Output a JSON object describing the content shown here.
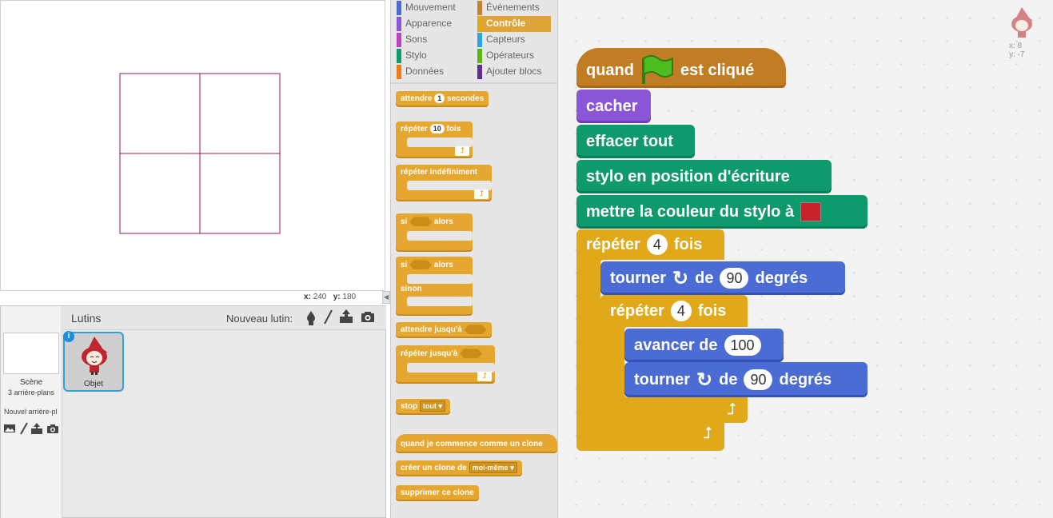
{
  "stage": {
    "x_label": "x:",
    "x_value": "240",
    "y_label": "y:",
    "y_value": "180",
    "toggle": "◀"
  },
  "sprites": {
    "header": "Lutins",
    "new_sprite_label": "Nouveau lutin:",
    "scene_label": "Scène",
    "scene_sub": "3 arrière-plans",
    "new_backdrop_label": "Nouvel arrière-pl",
    "sprite_name": "Objet",
    "info": "i"
  },
  "categories": [
    {
      "label": "Mouvement",
      "color": "#4a6cd4"
    },
    {
      "label": "Événements",
      "color": "#c88330"
    },
    {
      "label": "Apparence",
      "color": "#8a55d7"
    },
    {
      "label": "Contrôle",
      "color": "#e1a91a",
      "selected": true
    },
    {
      "label": "Sons",
      "color": "#bb42c3"
    },
    {
      "label": "Capteurs",
      "color": "#2ca5e2"
    },
    {
      "label": "Stylo",
      "color": "#0e9a6c"
    },
    {
      "label": "Opérateurs",
      "color": "#5cb712"
    },
    {
      "label": "Données",
      "color": "#ee7d16"
    },
    {
      "label": "Ajouter blocs",
      "color": "#632d99"
    }
  ],
  "palette": {
    "wait_a": "attendre",
    "wait_n": "1",
    "wait_b": "secondes",
    "repeat_a": "répéter",
    "repeat_n": "10",
    "repeat_b": "fois",
    "forever": "répéter indéfiniment",
    "if_a": "si",
    "if_b": "alors",
    "ifelse_a": "si",
    "ifelse_b": "alors",
    "else": "sinon",
    "wait_until": "attendre jusqu'à",
    "repeat_until": "répéter jusqu'à",
    "stop": "stop",
    "stop_opt": "tout ▾",
    "clone_hat": "quand je commence comme un clone",
    "create_clone": "créer un clone de",
    "create_opt": "moi-même ▾",
    "delete_clone": "supprimer ce clone"
  },
  "script": {
    "hat_a": "quand",
    "hat_b": "est cliqué",
    "hide": "cacher",
    "clear": "effacer tout",
    "pendown": "stylo en position d'écriture",
    "setcolor": "mettre la couleur du stylo à",
    "setcolor_value": "#c8232c",
    "rep1_a": "répéter",
    "rep1_n": "4",
    "rep1_b": "fois",
    "turn1_a": "tourner",
    "turn1_b": "de",
    "turn1_n": "90",
    "turn1_c": "degrés",
    "rep2_a": "répéter",
    "rep2_n": "4",
    "rep2_b": "fois",
    "move_a": "avancer de",
    "move_n": "100",
    "turn2_a": "tourner",
    "turn2_b": "de",
    "turn2_n": "90",
    "turn2_c": "degrés"
  },
  "corner": {
    "x": "x: 8",
    "y": "y: -7"
  }
}
